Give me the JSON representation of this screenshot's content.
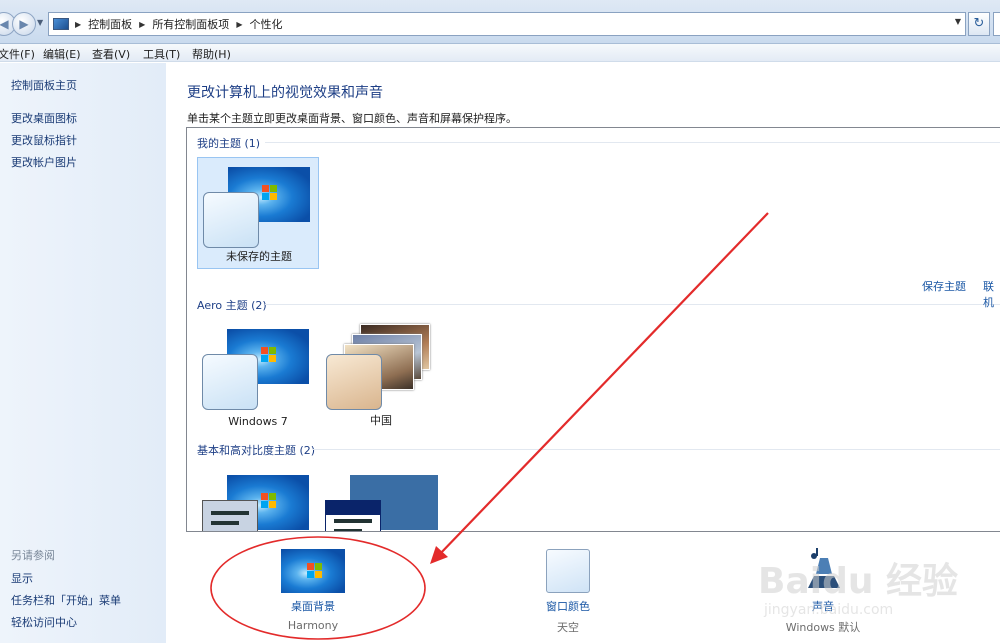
{
  "address": {
    "crumbs": [
      "控制面板",
      "所有控制面板项",
      "个性化"
    ]
  },
  "menu": [
    "文件(F)",
    "编辑(E)",
    "查看(V)",
    "工具(T)",
    "帮助(H)"
  ],
  "left_pane": {
    "home": "控制面板主页",
    "links": [
      "更改桌面图标",
      "更改鼠标指针",
      "更改帐户图片"
    ],
    "see_also_title": "另请参阅",
    "see_also": [
      "显示",
      "任务栏和「开始」菜单",
      "轻松访问中心"
    ]
  },
  "main": {
    "heading": "更改计算机上的视觉效果和声音",
    "subtitle": "单击某个主题立即更改桌面背景、窗口颜色、声音和屏幕保护程序。",
    "groups": {
      "my": {
        "header": "我的主题 (1)",
        "themes": [
          "未保存的主题"
        ]
      },
      "aero": {
        "header": "Aero 主题 (2)",
        "themes": [
          "Windows 7",
          "中国"
        ]
      },
      "basic": {
        "header": "基本和高对比度主题 (2)"
      }
    },
    "save_theme": "保存主题",
    "online_more": "联机"
  },
  "bottom": {
    "background": {
      "label": "桌面背景",
      "value": "Harmony"
    },
    "color": {
      "label": "窗口颜色",
      "value": "天空"
    },
    "sound": {
      "label": "声音",
      "value": "Windows 默认"
    }
  },
  "watermark": {
    "brand": "Baidu 经验",
    "url": "jingyan.baidu.com"
  },
  "colors": {
    "accent": "#1e3f86",
    "link": "#1a57a5",
    "selection": "#daebfc",
    "annotation": "#e32b2b"
  }
}
